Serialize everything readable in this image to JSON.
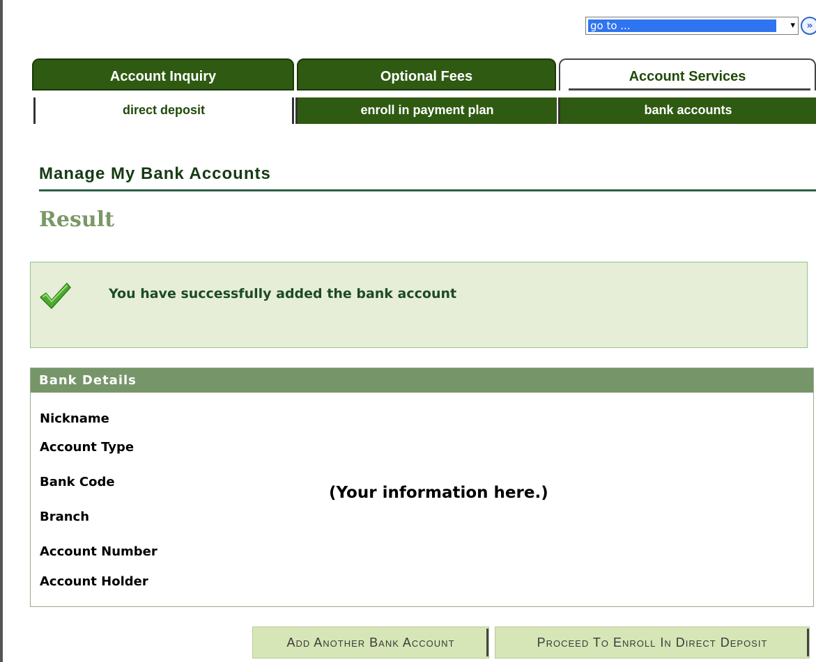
{
  "goto": {
    "value": "go to ...",
    "arrow": "▾",
    "button_symbol": "»"
  },
  "tabs": [
    {
      "label": "Account Inquiry",
      "active": false
    },
    {
      "label": "Optional Fees",
      "active": false
    },
    {
      "label": "Account Services",
      "active": true
    }
  ],
  "subtabs": [
    {
      "label": "direct deposit",
      "active": true
    },
    {
      "label": "enroll in payment plan",
      "active": false
    },
    {
      "label": "bank accounts",
      "active": false
    }
  ],
  "heading": "Manage My Bank Accounts",
  "result_title": "Result",
  "success": {
    "icon": "check-icon",
    "message": "You have successfully added the bank account"
  },
  "bank_details": {
    "header": "Bank Details",
    "fields": [
      "Nickname",
      "Account Type",
      "Bank Code",
      "Branch",
      "Account Number",
      "Account Holder"
    ],
    "info_note": "(Your information here.)"
  },
  "actions": {
    "add_another": "Add Another Bank Account",
    "proceed": "Proceed To Enroll In Direct Deposit"
  },
  "colors": {
    "tab_dark": "#2f5a12",
    "header_green": "#76966a",
    "success_bg": "#e6eed8",
    "button_bg": "#d6e6b6",
    "goto_highlight": "#2f74f0"
  }
}
